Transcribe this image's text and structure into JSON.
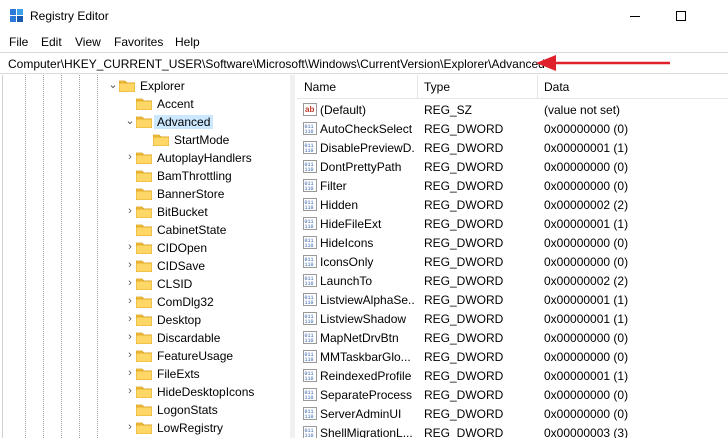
{
  "window": {
    "title": "Registry Editor"
  },
  "menu": [
    "File",
    "Edit",
    "View",
    "Favorites",
    "Help"
  ],
  "address": "Computer\\HKEY_CURRENT_USER\\Software\\Microsoft\\Windows\\CurrentVersion\\Explorer\\Advanced",
  "colors": {
    "arrow": "#e0202a",
    "selected": "#cce8ff",
    "folder": "#f5c242"
  },
  "tree": [
    {
      "label": "Explorer",
      "level": 0,
      "expanded": true
    },
    {
      "label": "Accent",
      "level": 1,
      "expanded": null
    },
    {
      "label": "Advanced",
      "level": 1,
      "expanded": true,
      "selected": true
    },
    {
      "label": "StartMode",
      "level": 2,
      "expanded": null
    },
    {
      "label": "AutoplayHandlers",
      "level": 1,
      "expanded": false
    },
    {
      "label": "BamThrottling",
      "level": 1,
      "expanded": null
    },
    {
      "label": "BannerStore",
      "level": 1,
      "expanded": null
    },
    {
      "label": "BitBucket",
      "level": 1,
      "expanded": false
    },
    {
      "label": "CabinetState",
      "level": 1,
      "expanded": null
    },
    {
      "label": "CIDOpen",
      "level": 1,
      "expanded": false
    },
    {
      "label": "CIDSave",
      "level": 1,
      "expanded": false
    },
    {
      "label": "CLSID",
      "level": 1,
      "expanded": false
    },
    {
      "label": "ComDlg32",
      "level": 1,
      "expanded": false
    },
    {
      "label": "Desktop",
      "level": 1,
      "expanded": false
    },
    {
      "label": "Discardable",
      "level": 1,
      "expanded": false
    },
    {
      "label": "FeatureUsage",
      "level": 1,
      "expanded": false
    },
    {
      "label": "FileExts",
      "level": 1,
      "expanded": false
    },
    {
      "label": "HideDesktopIcons",
      "level": 1,
      "expanded": false
    },
    {
      "label": "LogonStats",
      "level": 1,
      "expanded": null
    },
    {
      "label": "LowRegistry",
      "level": 1,
      "expanded": false
    }
  ],
  "columns": {
    "name": "Name",
    "type": "Type",
    "data": "Data"
  },
  "values": [
    {
      "name": "(Default)",
      "type": "REG_SZ",
      "data": "(value not set)",
      "kind": "sz"
    },
    {
      "name": "AutoCheckSelect",
      "type": "REG_DWORD",
      "data": "0x00000000 (0)",
      "kind": "dword"
    },
    {
      "name": "DisablePreviewD...",
      "type": "REG_DWORD",
      "data": "0x00000001 (1)",
      "kind": "dword"
    },
    {
      "name": "DontPrettyPath",
      "type": "REG_DWORD",
      "data": "0x00000000 (0)",
      "kind": "dword"
    },
    {
      "name": "Filter",
      "type": "REG_DWORD",
      "data": "0x00000000 (0)",
      "kind": "dword"
    },
    {
      "name": "Hidden",
      "type": "REG_DWORD",
      "data": "0x00000002 (2)",
      "kind": "dword"
    },
    {
      "name": "HideFileExt",
      "type": "REG_DWORD",
      "data": "0x00000001 (1)",
      "kind": "dword"
    },
    {
      "name": "HideIcons",
      "type": "REG_DWORD",
      "data": "0x00000000 (0)",
      "kind": "dword"
    },
    {
      "name": "IconsOnly",
      "type": "REG_DWORD",
      "data": "0x00000000 (0)",
      "kind": "dword"
    },
    {
      "name": "LaunchTo",
      "type": "REG_DWORD",
      "data": "0x00000002 (2)",
      "kind": "dword"
    },
    {
      "name": "ListviewAlphaSe...",
      "type": "REG_DWORD",
      "data": "0x00000001 (1)",
      "kind": "dword"
    },
    {
      "name": "ListviewShadow",
      "type": "REG_DWORD",
      "data": "0x00000001 (1)",
      "kind": "dword"
    },
    {
      "name": "MapNetDrvBtn",
      "type": "REG_DWORD",
      "data": "0x00000000 (0)",
      "kind": "dword"
    },
    {
      "name": "MMTaskbarGlo...",
      "type": "REG_DWORD",
      "data": "0x00000000 (0)",
      "kind": "dword"
    },
    {
      "name": "ReindexedProfile",
      "type": "REG_DWORD",
      "data": "0x00000001 (1)",
      "kind": "dword"
    },
    {
      "name": "SeparateProcess",
      "type": "REG_DWORD",
      "data": "0x00000000 (0)",
      "kind": "dword"
    },
    {
      "name": "ServerAdminUI",
      "type": "REG_DWORD",
      "data": "0x00000000 (0)",
      "kind": "dword"
    },
    {
      "name": "ShellMigrationL...",
      "type": "REG_DWORD",
      "data": "0x00000003 (3)",
      "kind": "dword"
    }
  ]
}
